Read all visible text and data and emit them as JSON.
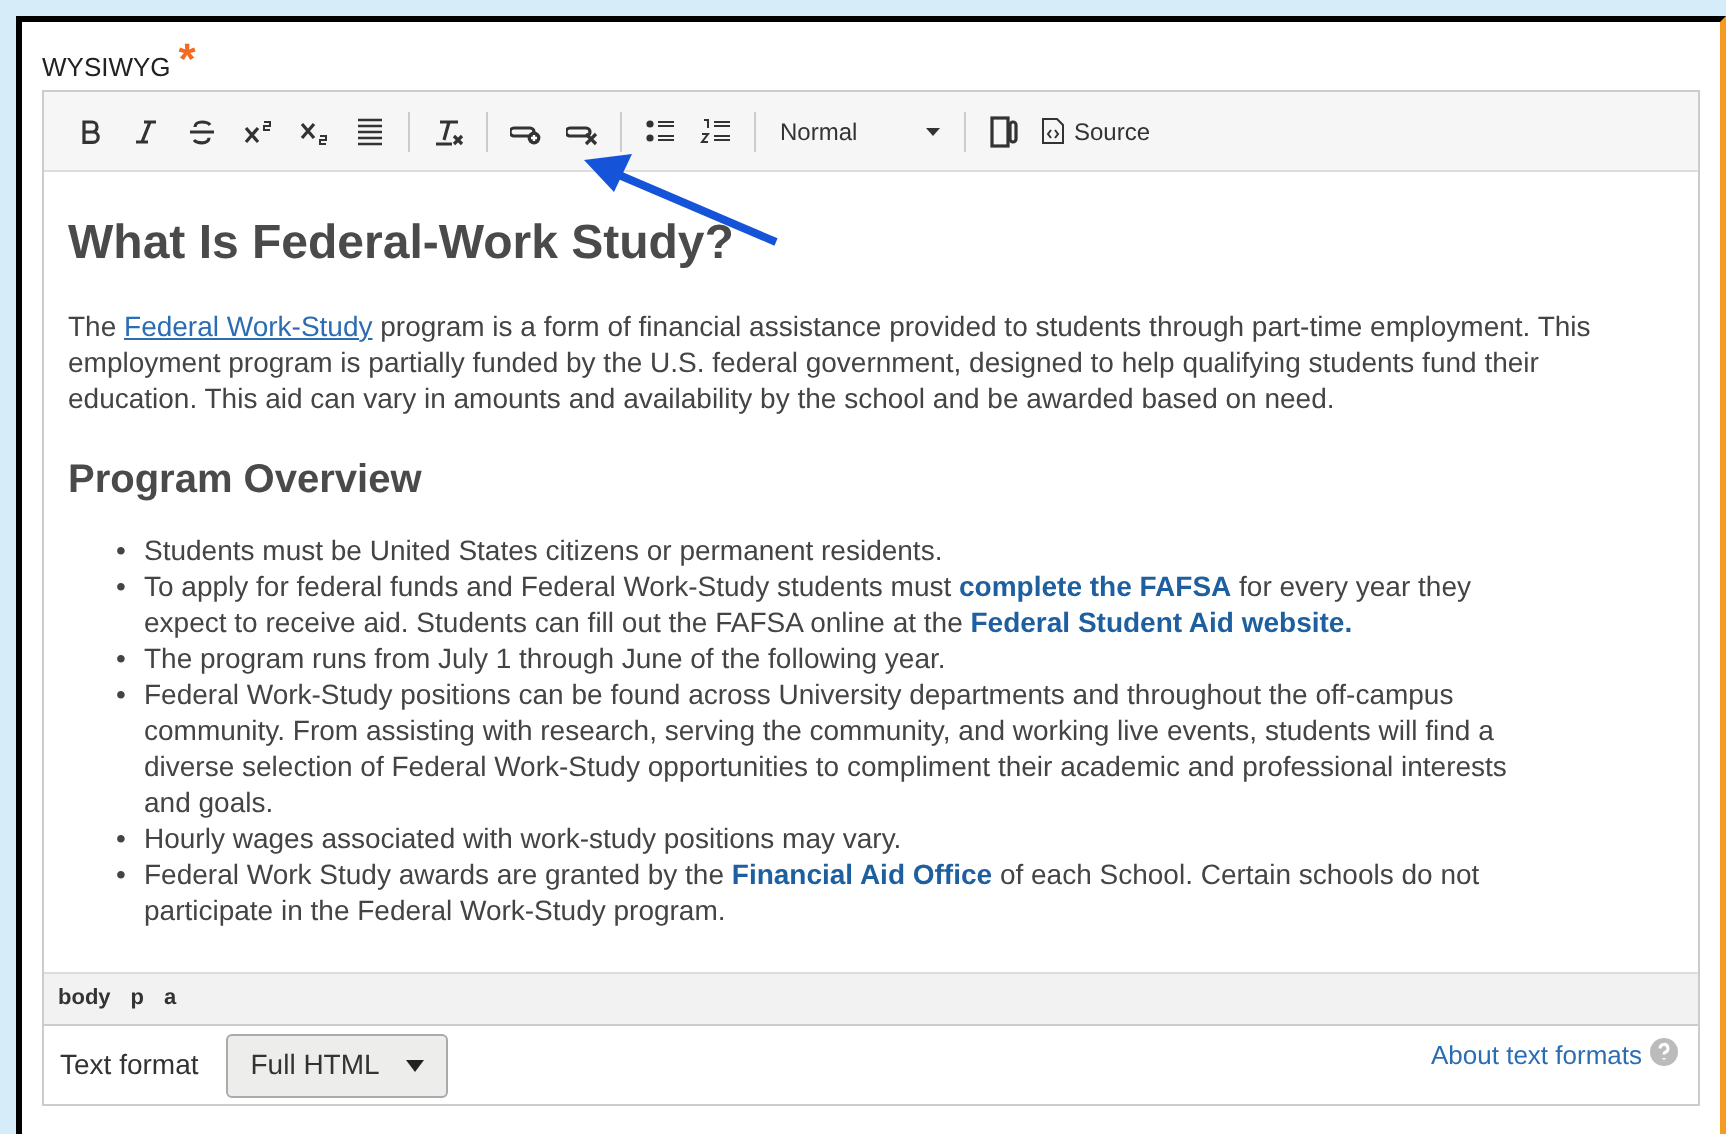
{
  "field": {
    "label": "WYSIWYG",
    "required_mark": "*"
  },
  "toolbar": {
    "format": "Normal",
    "source": "Source"
  },
  "content": [
    {
      "kind": "h1",
      "parts": [
        {
          "kind": "text",
          "text": "What Is Federal-Work Study?"
        }
      ]
    },
    {
      "kind": "p",
      "parts": [
        {
          "kind": "text",
          "text": "The "
        },
        {
          "kind": "link",
          "text": "Federal Work-Study"
        },
        {
          "kind": "text",
          "text": " program is a form of financial assistance provided to students through part-time employment. This employment program is partially funded by the U.S. federal government, designed to help qualifying students fund their education. This aid can vary in amounts and availability by the school and be awarded based on need."
        }
      ]
    },
    {
      "kind": "h2",
      "parts": [
        {
          "kind": "text",
          "text": "Program Overview"
        }
      ]
    },
    {
      "kind": "li",
      "marker": "•",
      "parts": [
        {
          "kind": "text",
          "text": "Students must be United States citizens or permanent residents."
        }
      ]
    },
    {
      "kind": "li",
      "marker": "•",
      "parts": [
        {
          "kind": "text",
          "text": "To apply for federal funds and Federal Work-Study students must "
        },
        {
          "kind": "strong_link",
          "text": "complete the FAFSA"
        },
        {
          "kind": "text",
          "text": " for every year they expect to receive aid. Students can fill out the FAFSA online at the "
        },
        {
          "kind": "strong_link",
          "text": "Federal Student Aid website."
        }
      ]
    },
    {
      "kind": "li",
      "marker": "•",
      "parts": [
        {
          "kind": "text",
          "text": "The program runs from July 1 through June of the following year."
        }
      ]
    },
    {
      "kind": "li",
      "marker": "•",
      "parts": [
        {
          "kind": "text",
          "text": "Federal Work-Study positions can be found across University departments and throughout the off-campus community. From assisting with research, serving the community, and working live events, students will find a diverse selection of Federal Work-Study opportunities to compliment their academic and professional interests and goals."
        }
      ]
    },
    {
      "kind": "li",
      "marker": "•",
      "parts": [
        {
          "kind": "text",
          "text": "Hourly wages associated with work-study positions may vary."
        }
      ]
    },
    {
      "kind": "li",
      "marker": "•",
      "parts": [
        {
          "kind": "text",
          "text": "Federal Work Study awards are granted by the "
        },
        {
          "kind": "strong_link",
          "text": "Financial Aid Office"
        },
        {
          "kind": "text",
          "text": " of each School. Certain schools do not participate in the Federal Work-Study program."
        }
      ]
    }
  ],
  "path": [
    "body",
    "p",
    "a"
  ],
  "text_format": {
    "label": "Text format",
    "value": "Full HTML",
    "help_link": "About text formats"
  }
}
